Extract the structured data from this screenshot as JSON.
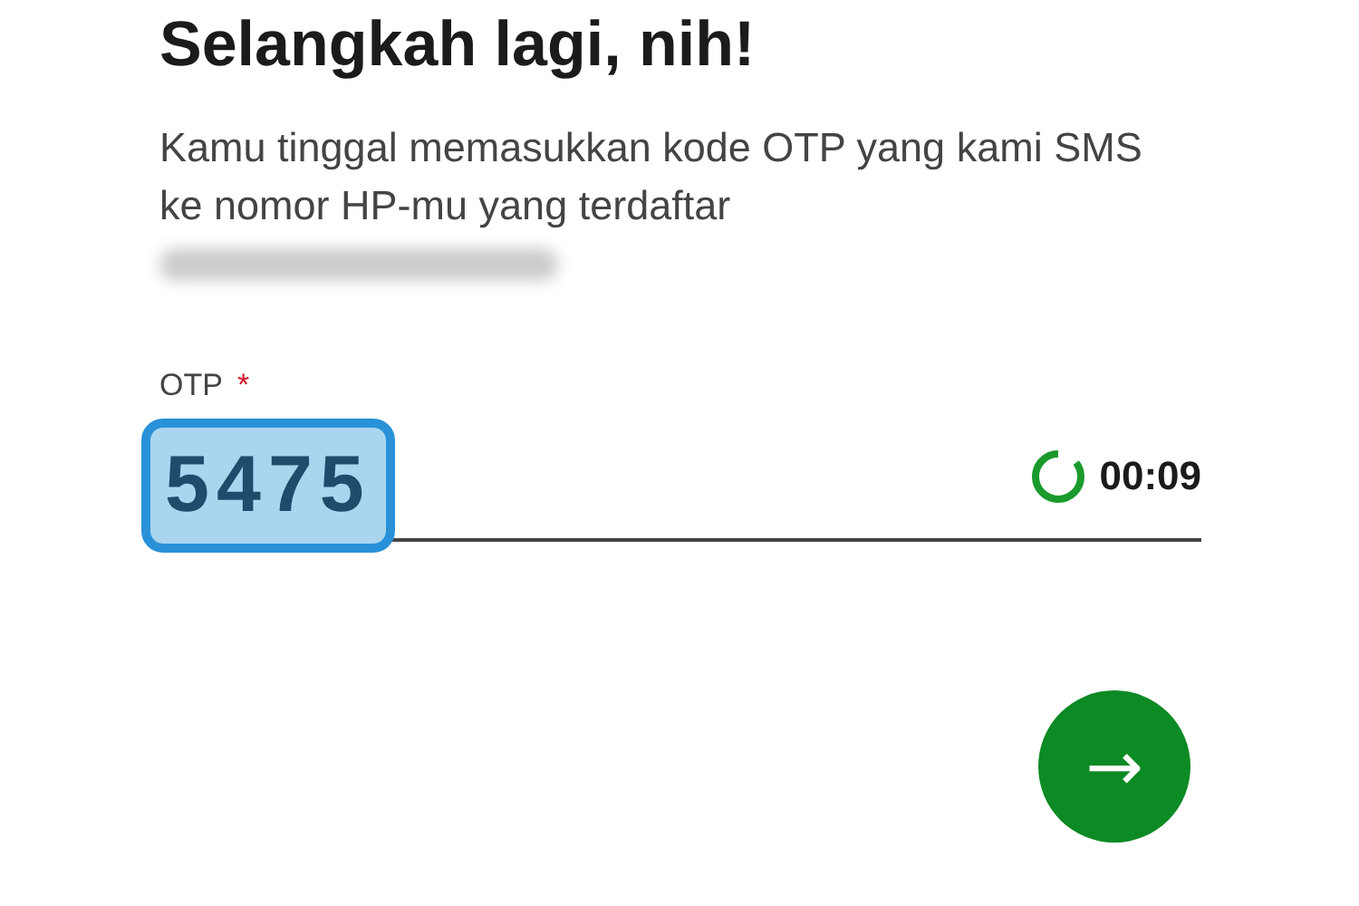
{
  "title": "Selangkah lagi, nih!",
  "description": "Kamu tinggal memasukkan kode OTP yang kami SMS ke nomor HP-mu yang terdaftar",
  "otp": {
    "label": "OTP",
    "required_mark": "*",
    "value": "5475",
    "highlighted": true
  },
  "timer": {
    "level": 0.85,
    "text": "00:09"
  },
  "next_button": {
    "icon": "→"
  }
}
